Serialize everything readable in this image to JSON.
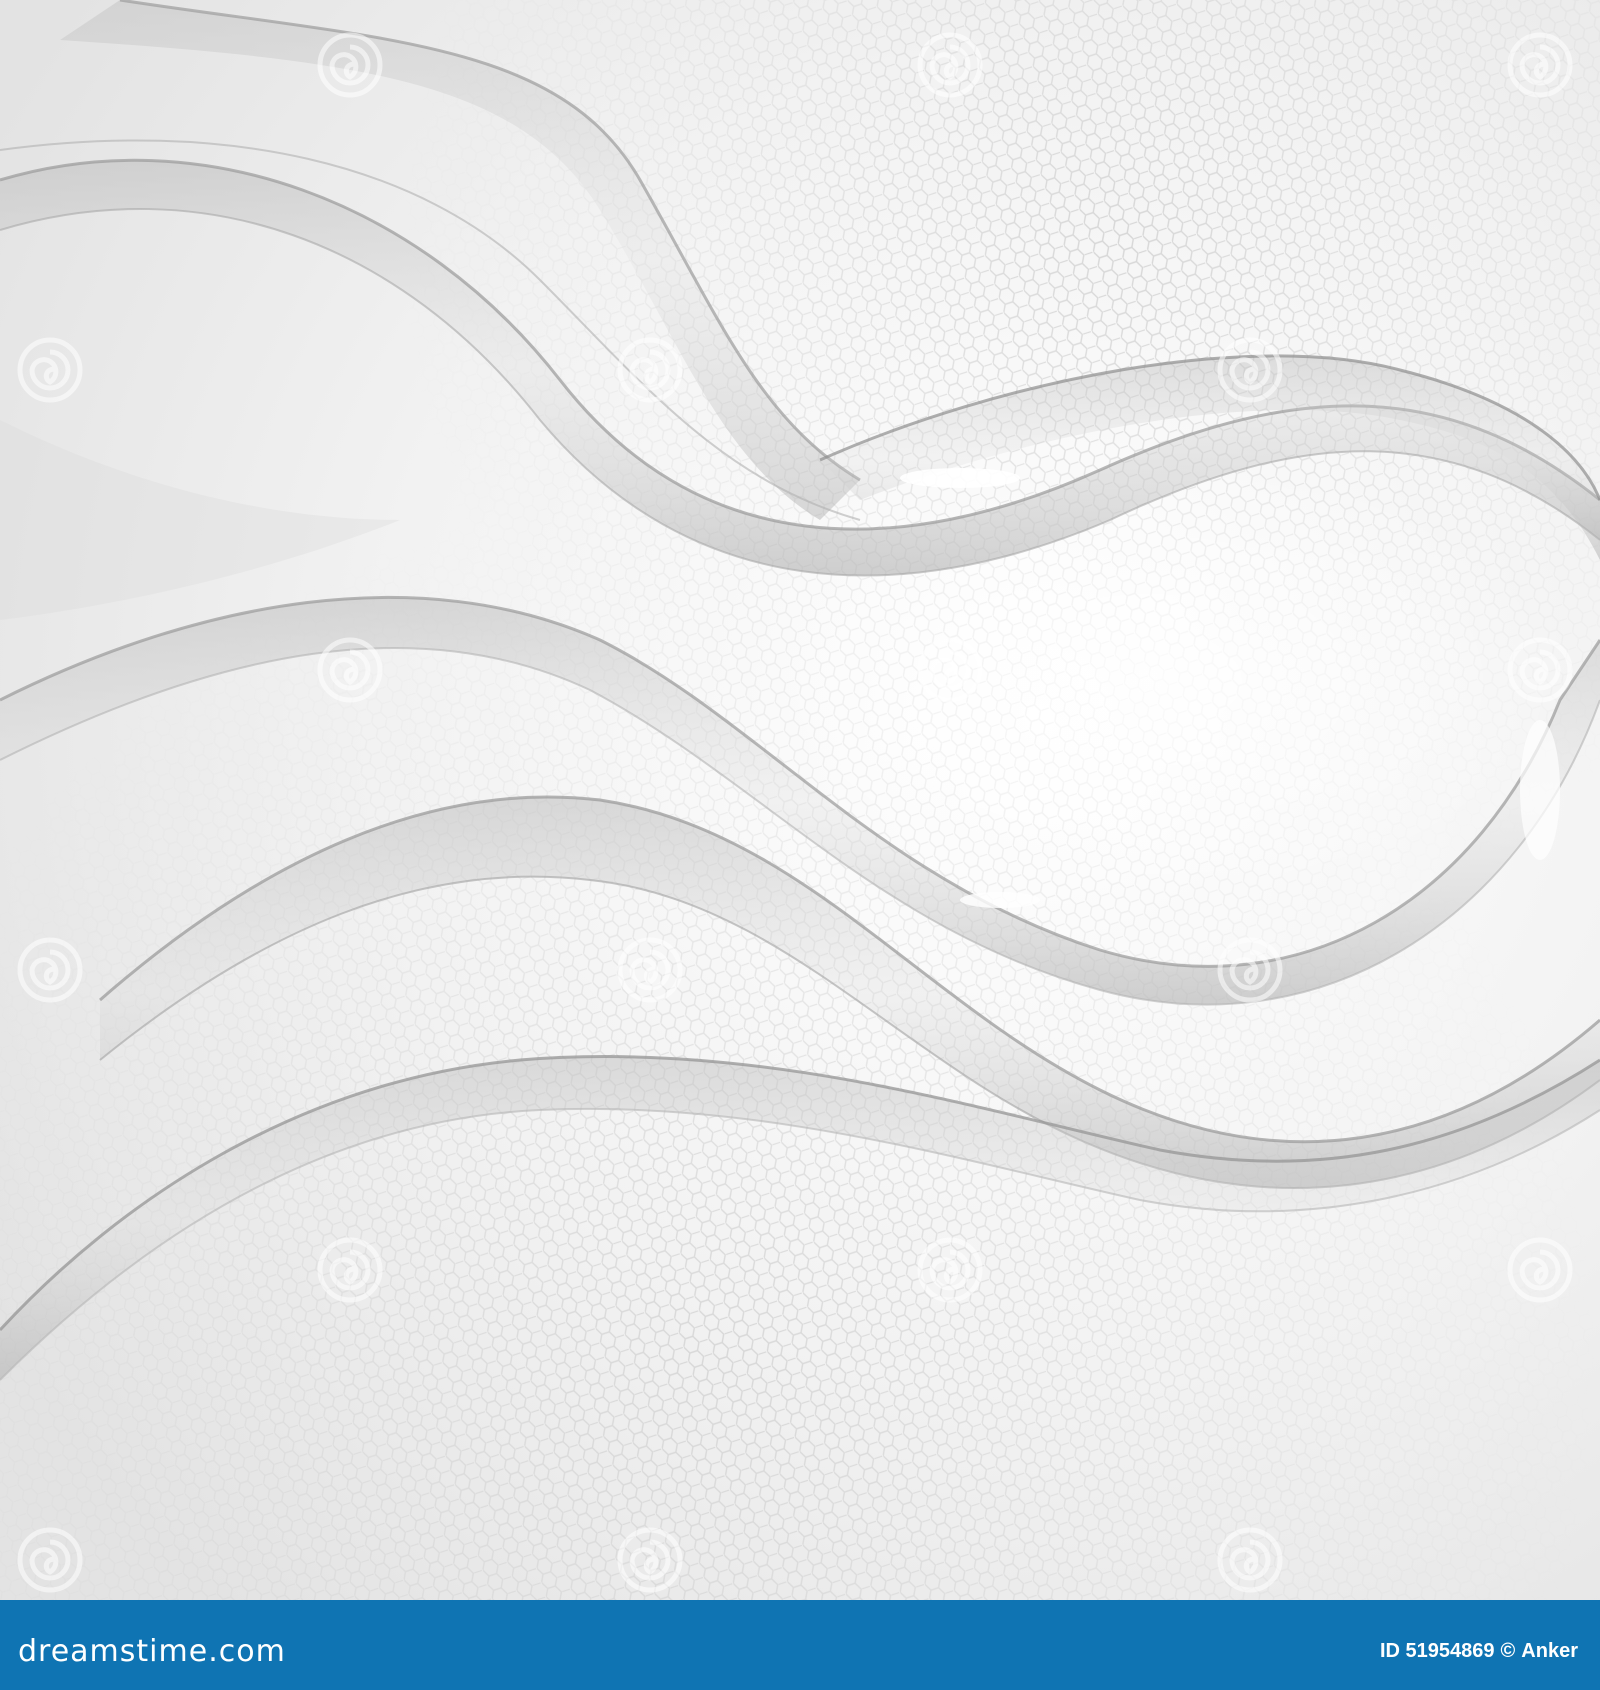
{
  "watermark": {
    "wordmark": "dreamstime",
    "logo_text": "dreamstime.com"
  },
  "footer": {
    "background_color": "#0f74b3",
    "logo_text": "dreamstime.com",
    "image_id": "ID 51954869",
    "copyright_symbol": "©",
    "author": "Anker"
  },
  "artwork": {
    "background_color": "#f1f1f1",
    "wave_color": "#9a9a9a",
    "pattern": "hexagon-mesh"
  }
}
